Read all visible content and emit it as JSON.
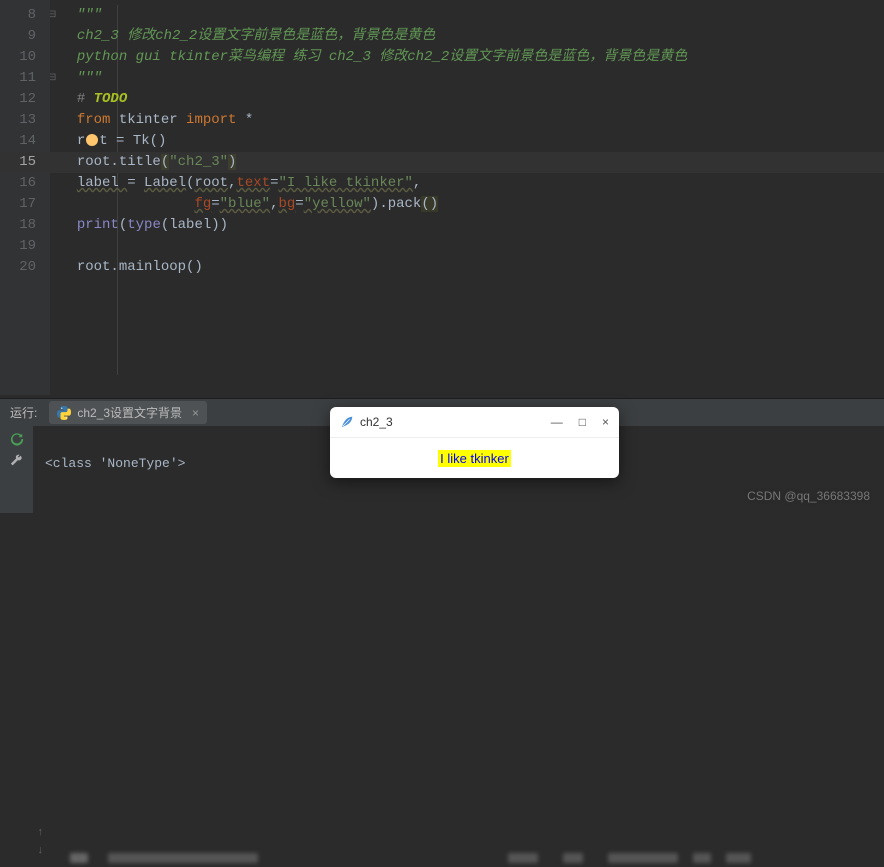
{
  "editor": {
    "lines": [
      8,
      9,
      10,
      11,
      12,
      13,
      14,
      15,
      16,
      17,
      18,
      19,
      20
    ],
    "current": 15,
    "code": {
      "l8": "\"\"\"",
      "l9": "ch2_3 修改ch2_2设置文字前景色是蓝色，背景色是黄色",
      "l10": "python gui tkinter菜鸟编程 练习 ch2_3 修改ch2_2设置文字前景色是蓝色，背景色是黄色",
      "l11": "\"\"\"",
      "l12_a": "# ",
      "l12_b": "TODO",
      "l13_from": "from ",
      "l13_mod": "tkinter ",
      "l13_import": "import ",
      "l13_star": "*",
      "l14_a": "r",
      "l14_b": "t = Tk",
      "l14_c": "()",
      "l15_a": "root.title",
      "l15_b": "(",
      "l15_c": "\"ch2_3\"",
      "l15_d": ")",
      "l16_a": "label ",
      "l16_eq": "= ",
      "l16_b": "Label",
      "l16_c": "(",
      "l16_d": "root",
      "l16_e": ",",
      "l16_f": "text",
      "l16_g": "=",
      "l16_h": "\"I like tkinker\"",
      "l16_i": ",",
      "l17_pad": "              ",
      "l17_a": "fg",
      "l17_b": "=",
      "l17_c": "\"blue\"",
      "l17_d": ",",
      "l17_e": "bg",
      "l17_f": "=",
      "l17_g": "\"yellow\"",
      "l17_h": ")",
      "l17_i": ".pack",
      "l17_j": "()",
      "l18_a": "print",
      "l18_b": "(",
      "l18_c": "type",
      "l18_d": "(",
      "l18_e": "label",
      "l18_f": "))",
      "l20_a": "root.mainloop",
      "l20_b": "()"
    }
  },
  "run": {
    "label": "运行:",
    "tab": "ch2_3设置文字背景",
    "output": "<class 'NoneType'>"
  },
  "tk": {
    "title": "ch2_3",
    "label": "I like tkinker"
  },
  "watermark": "CSDN @qq_36683398",
  "icons": {
    "min": "—",
    "max": "□",
    "close": "×"
  }
}
